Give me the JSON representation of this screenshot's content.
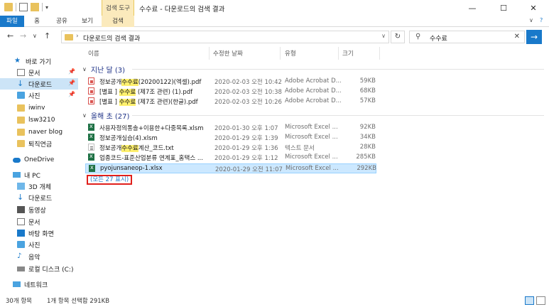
{
  "titlebar": {
    "tools_label": "검색 도구",
    "title": "수수료 - 다운로드의 검색 결과",
    "minimize": "—",
    "maximize": "☐",
    "close": "✕"
  },
  "ribbon": {
    "tabs": [
      "파일",
      "홈",
      "공유",
      "보기",
      "검색"
    ],
    "expand": "∨",
    "help": "?"
  },
  "address": {
    "path": "다운로드의 검색 결과",
    "search_value": "수수료"
  },
  "sidebar": {
    "items": [
      {
        "label": "바로 가기",
        "icon": "star-icon"
      },
      {
        "label": "문서",
        "icon": "document-icon"
      },
      {
        "label": "다운로드",
        "icon": "download-icon"
      },
      {
        "label": "사진",
        "icon": "pictures-icon"
      },
      {
        "label": "iwinv",
        "icon": "folder-icon"
      },
      {
        "label": "lsw3210",
        "icon": "folder-icon"
      },
      {
        "label": "naver blog",
        "icon": "folder-icon"
      },
      {
        "label": "퇴직연금",
        "icon": "folder-icon"
      },
      {
        "label": "OneDrive",
        "icon": "cloud-icon"
      },
      {
        "label": "내 PC",
        "icon": "computer-icon"
      },
      {
        "label": "3D 개체",
        "icon": "cube-icon"
      },
      {
        "label": "다운로드",
        "icon": "download-icon"
      },
      {
        "label": "동영상",
        "icon": "video-icon"
      },
      {
        "label": "문서",
        "icon": "document-icon"
      },
      {
        "label": "바탕 화면",
        "icon": "desktop-icon"
      },
      {
        "label": "사진",
        "icon": "pictures-icon"
      },
      {
        "label": "음악",
        "icon": "music-icon"
      },
      {
        "label": "로컬 디스크 (C:)",
        "icon": "disk-icon"
      },
      {
        "label": "네트워크",
        "icon": "network-icon"
      }
    ]
  },
  "columns": {
    "name": "이름",
    "date": "수정한 날짜",
    "type": "유형",
    "size": "크기"
  },
  "groups": [
    {
      "label": "지난 달 (3)",
      "files": [
        {
          "pre": "정보공개",
          "hl": "수수료",
          "post": "(20200122)(엑셀).pdf",
          "date": "2020-02-03 오전 10:42",
          "type": "Adobe Acrobat D...",
          "size": "59KB",
          "icon": "pdf"
        },
        {
          "pre": "[별표 ] ",
          "hl": "수수료",
          "post": " (제7조 관련) (1).pdf",
          "date": "2020-02-03 오전 10:38",
          "type": "Adobe Acrobat D...",
          "size": "68KB",
          "icon": "pdf"
        },
        {
          "pre": "[별표 ] ",
          "hl": "수수료",
          "post": " (제7조 관련)(한글).pdf",
          "date": "2020-02-03 오전 10:26",
          "type": "Adobe Acrobat D...",
          "size": "57KB",
          "icon": "pdf"
        }
      ]
    },
    {
      "label": "올해 초 (27)",
      "files": [
        {
          "pre": "사용자정의통솔+이용한+다중목록.xlsm",
          "hl": "",
          "post": "",
          "date": "2020-01-30 오후 1:07",
          "type": "Microsoft Excel ...",
          "size": "92KB",
          "icon": "excel"
        },
        {
          "pre": "정보공개실습(4).xlsm",
          "hl": "",
          "post": "",
          "date": "2020-01-29 오후 1:39",
          "type": "Microsoft Excel ...",
          "size": "34KB",
          "icon": "excel"
        },
        {
          "pre": "정보공개",
          "hl": "수수료",
          "post": "계산_코드.txt",
          "date": "2020-01-29 오후 1:36",
          "type": "텍스트 문서",
          "size": "28KB",
          "icon": "text"
        },
        {
          "pre": "업종코드-표준산업분류 연계표_홈택스 ...",
          "hl": "",
          "post": "",
          "date": "2020-01-29 오후 1:12",
          "type": "Microsoft Excel ...",
          "size": "285KB",
          "icon": "excel"
        },
        {
          "pre": "pyojunsaneop-1.xlsx",
          "hl": "",
          "post": "",
          "date": "2020-01-29 오전 11:07",
          "type": "Microsoft Excel ...",
          "size": "292KB",
          "icon": "excel",
          "selected": true
        }
      ]
    }
  ],
  "show_all": "(모든 27 표시)",
  "status": {
    "count": "30개 항목",
    "selection": "1개 항목 선택함 291KB"
  },
  "colors": {
    "accent": "#1979ca",
    "highlight": "#fff06e",
    "selection": "#cce8ff",
    "show_all_border": "#e0201c"
  }
}
